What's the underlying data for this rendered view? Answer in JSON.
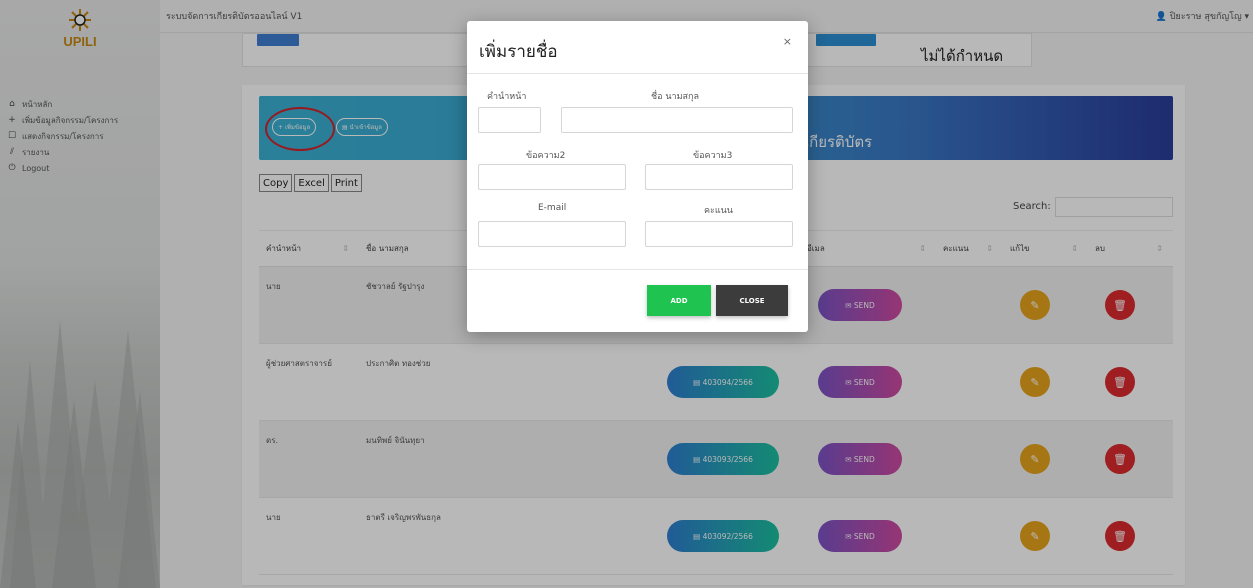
{
  "app": {
    "logo_text": "UPILI",
    "title": "ระบบจัดการเกียรติบัตรออนไลน์ V1",
    "user": "ปิยะราษ สุขกัญโญ ▾"
  },
  "sidebar": {
    "items": [
      {
        "icon": "home-icon",
        "label": "หน้าหลัก"
      },
      {
        "icon": "plus-icon",
        "label": "เพิ่มข้อมูลกิจกรรม/โครงการ"
      },
      {
        "icon": "list-icon",
        "label": "แสดงกิจกรรม/โครงการ"
      },
      {
        "icon": "chart-icon",
        "label": "รายงาน"
      },
      {
        "icon": "power-icon",
        "label": "Logout"
      }
    ]
  },
  "stats": {
    "status_text": "ไม่ได้กำหนด"
  },
  "hero": {
    "title": "เกียรติบัตร",
    "add_btn": "เพิ่มข้อมูล",
    "import_btn": "นำเข้าข้อมูล"
  },
  "toolbar": {
    "copy": "Copy",
    "excel": "Excel",
    "print": "Print",
    "search_label": "Search:"
  },
  "table": {
    "headers": [
      "คำนำหน้า",
      "ชื่อ นามสกุล",
      "",
      "",
      "",
      "อีเมล",
      "คะแนน",
      "แก้ไข",
      "ลบ"
    ],
    "send_label": "SEND",
    "rows": [
      {
        "prefix": "นาย",
        "name": "ชัชวาลย์ รัฐปารุง",
        "cert": ""
      },
      {
        "prefix": "ผู้ช่วยศาสตราจารย์",
        "name": "ประกาศิต ทองช่วย",
        "cert": "403094/2566"
      },
      {
        "prefix": "ดร.",
        "name": "มนทิพย์ จินันทุยา",
        "cert": "403093/2566"
      },
      {
        "prefix": "นาย",
        "name": "ธาตรี เจริญพรพันธกุล",
        "cert": "403092/2566"
      }
    ]
  },
  "modal": {
    "title": "เพิ่มรายชื่อ",
    "close_x": "×",
    "prefix_label": "คำนำหน้า",
    "name_label": "ชื่อ นามสกุล",
    "text2_label": "ข้อความ2",
    "text3_label": "ข้อความ3",
    "email_label": "E-mail",
    "score_label": "คะแนน",
    "add_btn": "ADD",
    "close_btn": "CLOSE"
  },
  "colors": {
    "accent": "#3bb2d4",
    "add": "#1ec44f",
    "close": "#3c3c3c",
    "edit": "#e8a41c",
    "delete": "#dd2a2e"
  }
}
